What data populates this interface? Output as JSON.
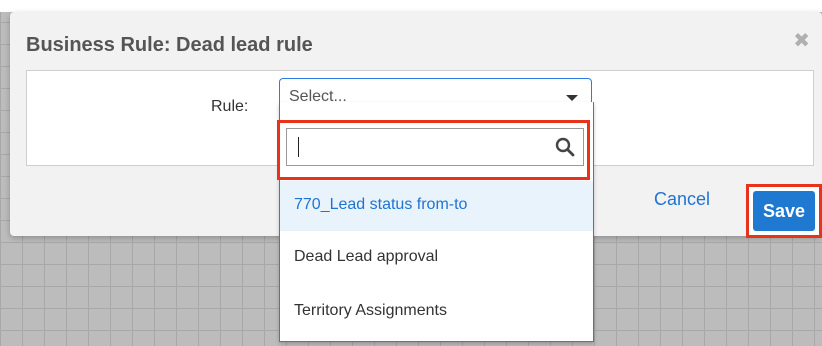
{
  "dialog": {
    "title": "Business Rule: Dead lead rule",
    "close_symbol": "✖",
    "rule_label": "Rule:",
    "select_placeholder": "Select...",
    "search_placeholder": "",
    "options": [
      {
        "label": "770_Lead status from-to",
        "highlighted": true
      },
      {
        "label": "Dead Lead approval",
        "highlighted": false
      },
      {
        "label": "Territory Assignments",
        "highlighted": false
      }
    ],
    "cancel_label": "Cancel",
    "save_label": "Save"
  },
  "colors": {
    "accent": "#1f79d1",
    "highlight_border": "#e8331a",
    "active_option_bg": "#e9f3fc"
  },
  "icons": {
    "close": "close-icon",
    "caret": "caret-down-icon",
    "search": "search-icon"
  }
}
